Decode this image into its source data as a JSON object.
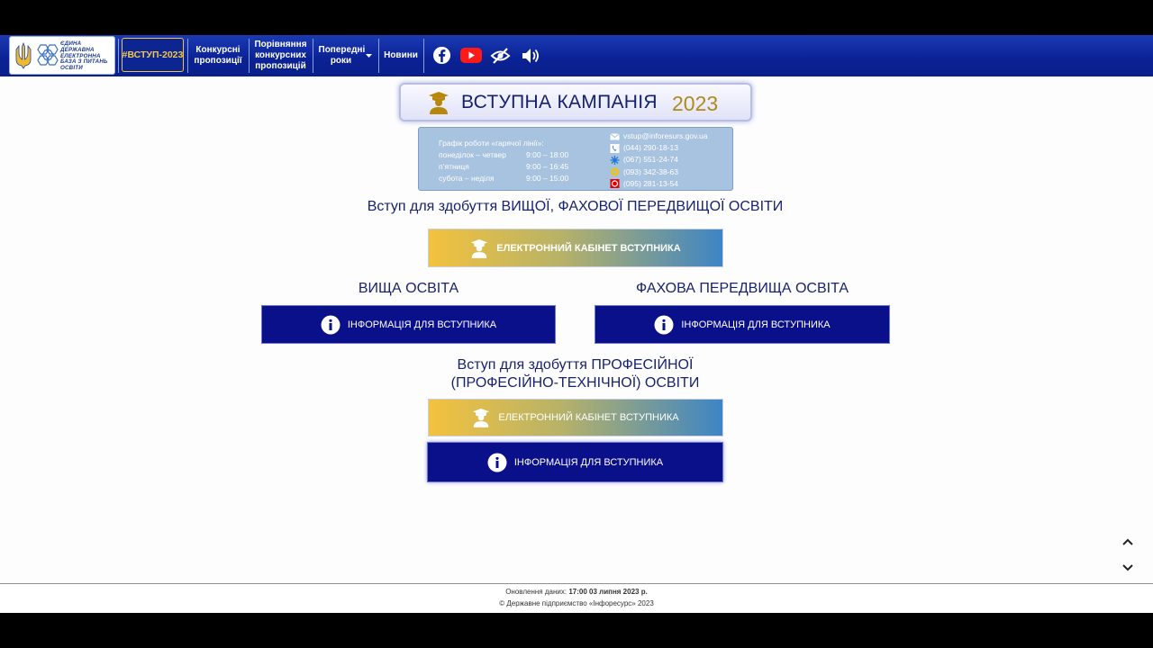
{
  "nav": {
    "logo_lines": [
      "ЄДИНА",
      "ДЕРЖАВНА",
      "ЕЛЕКТРОННА",
      "БАЗА З ПИТАНЬ",
      "ОСВІТИ"
    ],
    "vstup": "#ВСТУП-2023",
    "items": [
      {
        "label": "Конкурсні пропозиції"
      },
      {
        "label": "Порівняння конкурсних пропозицій"
      },
      {
        "label": "Попередні роки"
      },
      {
        "label": "Новини"
      }
    ],
    "icons": [
      "facebook-icon",
      "youtube-icon",
      "accessibility-icon",
      "sound-icon"
    ]
  },
  "hero": {
    "title": "ВСТУПНА КАМПАНІЯ",
    "year": "2023"
  },
  "hotline": {
    "title": "Графік роботи «гарячої лінії»:",
    "schedule": [
      {
        "days": "понеділок – четвер",
        "time": "9:00 – 18:00"
      },
      {
        "days": "п’ятниця",
        "time": "9:00 – 16:45"
      },
      {
        "days": "субота – неділя",
        "time": "9:00 – 15:00"
      }
    ],
    "contacts": [
      {
        "icon": "mail-icon",
        "text": "vstup@inforesurs.gov.ua"
      },
      {
        "icon": "phone-icon",
        "text": "(044) 290-18-13"
      },
      {
        "icon": "kyivstar-icon",
        "text": "(067) 551-24-74"
      },
      {
        "icon": "lifecell-icon",
        "text": "(093) 342-38-63"
      },
      {
        "icon": "vodafone-icon",
        "text": "(095) 281-13-54"
      }
    ]
  },
  "higher": {
    "heading": "Вступ для здобуття ВИЩОЇ, ФАХОВОЇ ПЕРЕДВИЩОЇ ОСВІТИ",
    "cabinet_btn": "ЕЛЕКТРОННИЙ КАБІНЕТ ВСТУПНИКА",
    "left_heading": "ВИЩА ОСВІТА",
    "right_heading": "ФАХОВА ПЕРЕДВИЩА ОСВІТА",
    "info_btn": "ІНФОРМАЦІЯ ДЛЯ ВСТУПНИКА"
  },
  "vocational": {
    "heading_line1": "Вступ для здобуття ПРОФЕСІЙНОЇ",
    "heading_line2": "(ПРОФЕСІЙНО-ТЕХНІЧНОЇ) ОСВІТИ",
    "cabinet_btn": "ЕЛЕКТРОННИЙ КАБІНЕТ ВСТУПНИКА",
    "info_btn": "ІНФОРМАЦІЯ ДЛЯ ВСТУПНИКА"
  },
  "footer": {
    "update_label": "Оновлення даних:",
    "update_value": "17:00 03 липня 2023 р.",
    "copyright": "© Державне підприємство «Інфоресурс» 2023"
  },
  "colors": {
    "navbar": "#0b2296",
    "navy_button": "#0a0f8a",
    "gold": "#f3c74c",
    "heading": "#19236e"
  }
}
